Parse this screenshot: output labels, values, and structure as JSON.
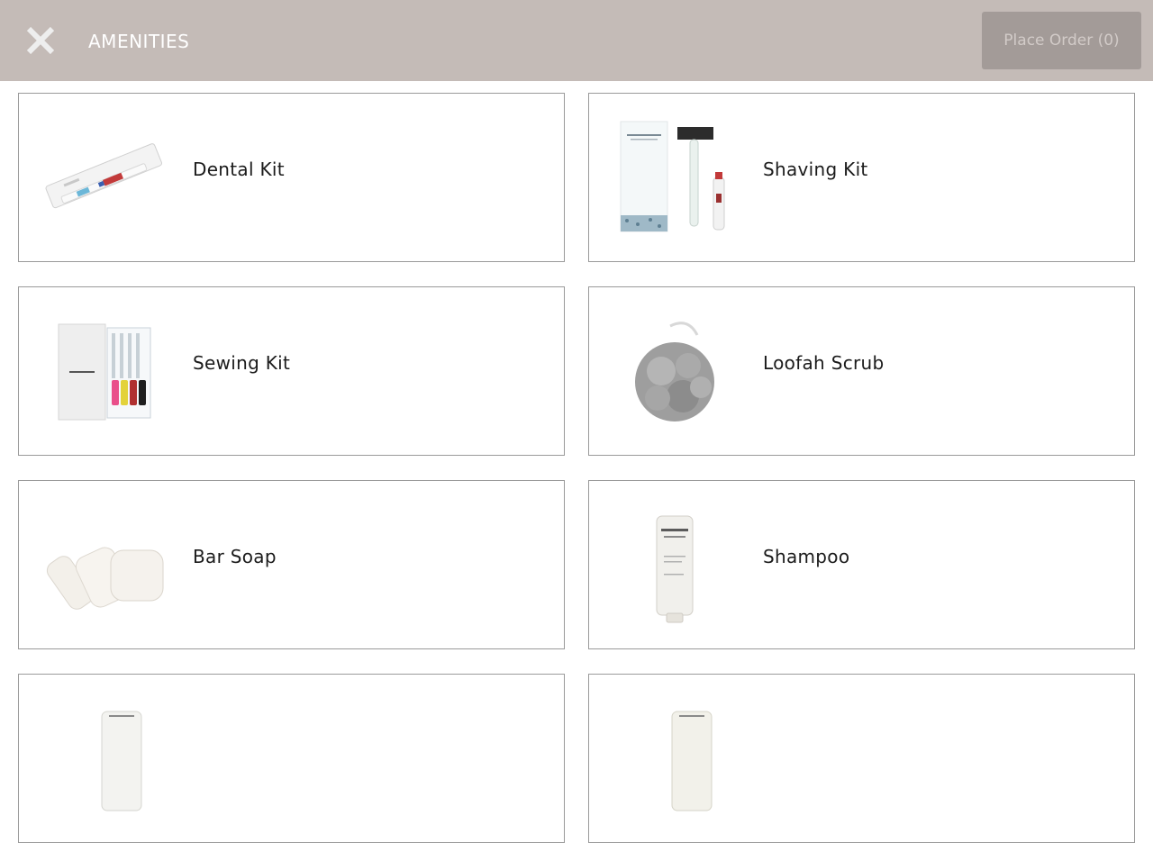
{
  "header": {
    "title": "AMENITIES",
    "order_button_label": "Place Order (0)",
    "close_icon": "close-icon"
  },
  "items": [
    {
      "label": "Dental Kit",
      "image": "dental-kit-image"
    },
    {
      "label": "Shaving Kit",
      "image": "shaving-kit-image"
    },
    {
      "label": "Sewing Kit",
      "image": "sewing-kit-image"
    },
    {
      "label": "Loofah Scrub",
      "image": "loofah-scrub-image"
    },
    {
      "label": "Bar Soap",
      "image": "bar-soap-image"
    },
    {
      "label": "Shampoo",
      "image": "shampoo-image"
    },
    {
      "label": "",
      "image": "bottle-image"
    },
    {
      "label": "",
      "image": "bottle-image"
    }
  ],
  "colors": {
    "header_bg": "#c4bbb7",
    "order_button_bg": "#a39b98",
    "card_border": "#9a9a9a"
  }
}
